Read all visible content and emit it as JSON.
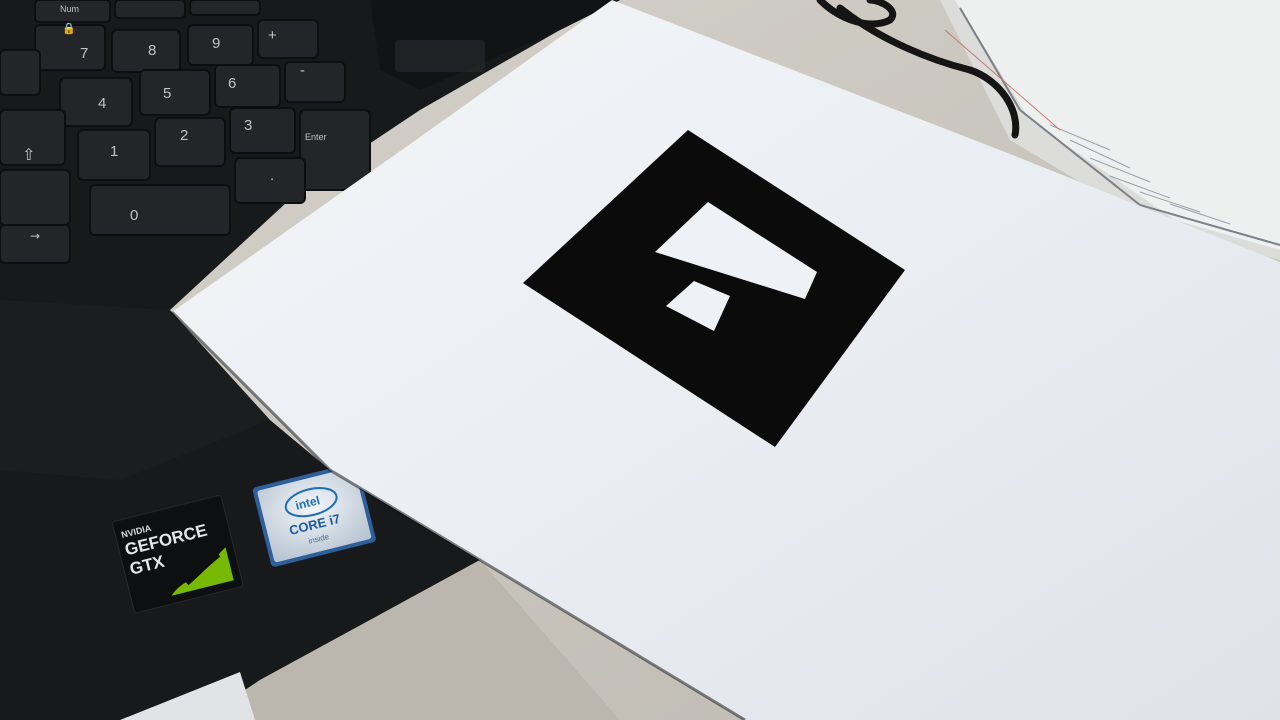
{
  "keyboard": {
    "numpad_keys": [
      "7",
      "8",
      "9",
      "+",
      "4",
      "5",
      "6",
      "1",
      "2",
      "3",
      "0",
      ".",
      "Enter",
      "Num",
      "-"
    ]
  },
  "stickers": {
    "nvidia": {
      "brand": "NVIDIA",
      "line1": "GEFORCE",
      "line2": "GTX"
    },
    "intel": {
      "brand": "intel",
      "line1": "CORE i7",
      "line2": "inside"
    }
  },
  "marker": {
    "type": "fiducial-marker"
  },
  "colors": {
    "laptop_body": "#18191b",
    "key_cap": "#232528",
    "paper": "#eef1f5",
    "marker_ink": "#0b0b0b",
    "desk": "#c9c6c0",
    "nvidia_green": "#77b900",
    "intel_blue": "#1b6fb5"
  }
}
